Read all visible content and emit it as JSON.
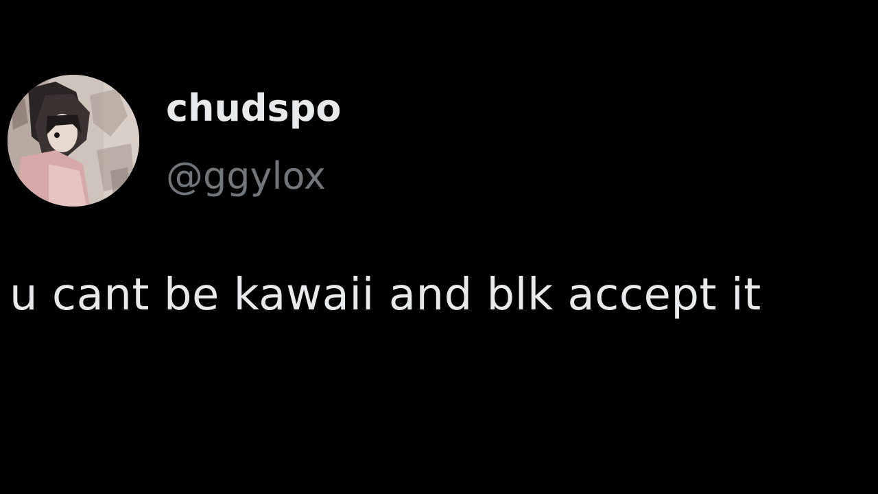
{
  "tweet": {
    "author": {
      "display_name": "chudspo",
      "handle": "@ggylox"
    },
    "avatar_icon": "profile-avatar-icon",
    "text": "u cant be kawaii and blk accept it"
  },
  "colors": {
    "background": "#000000",
    "primary_text": "#e7e9ea",
    "secondary_text": "#71767b"
  }
}
